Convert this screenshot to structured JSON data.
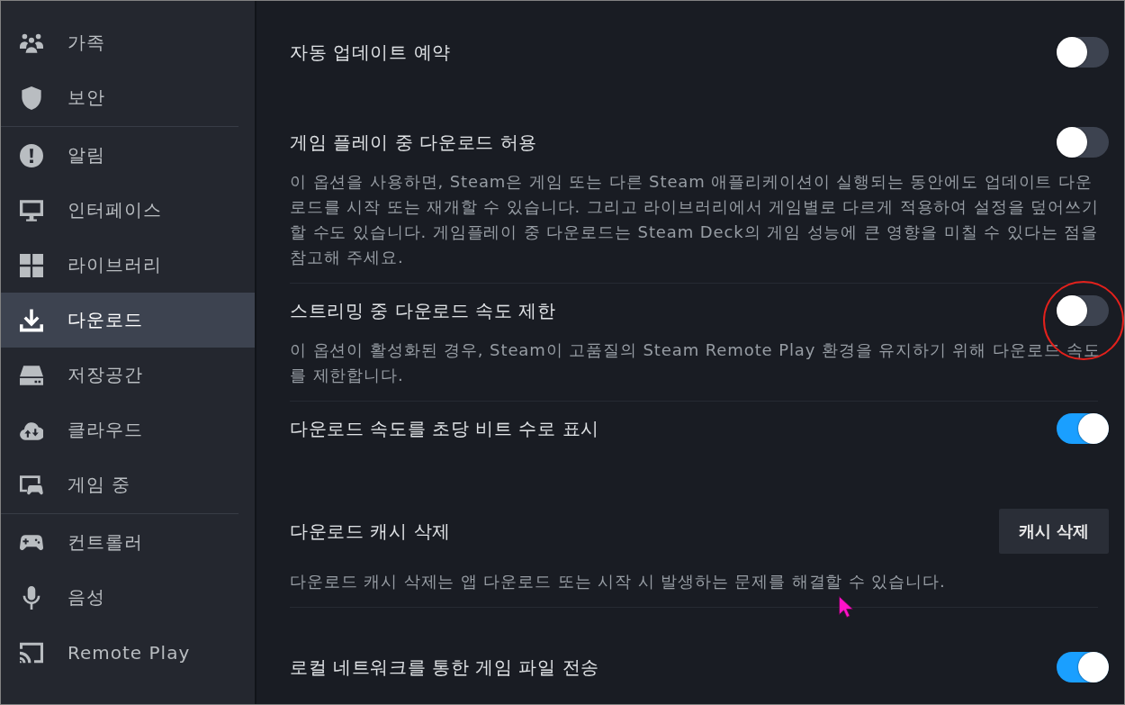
{
  "sidebar": {
    "groups": [
      {
        "items": [
          {
            "label": "가족",
            "selected": false
          },
          {
            "label": "보안",
            "selected": false
          }
        ]
      },
      {
        "items": [
          {
            "label": "알림",
            "selected": false
          },
          {
            "label": "인터페이스",
            "selected": false
          },
          {
            "label": "라이브러리",
            "selected": false
          },
          {
            "label": "다운로드",
            "selected": true
          },
          {
            "label": "저장공간",
            "selected": false
          },
          {
            "label": "클라우드",
            "selected": false
          },
          {
            "label": "게임 중",
            "selected": false
          }
        ]
      },
      {
        "items": [
          {
            "label": "컨트롤러",
            "selected": false
          },
          {
            "label": "음성",
            "selected": false
          },
          {
            "label": "Remote Play",
            "selected": false
          }
        ]
      }
    ]
  },
  "sections": [
    {
      "rows": [
        {
          "kind": "toggle",
          "title": "자동 업데이트 예약",
          "on": false
        }
      ]
    },
    {
      "rows": [
        {
          "kind": "toggle",
          "title": "게임 플레이 중 다운로드 허용",
          "on": false,
          "description": "이 옵션을 사용하면, Steam은 게임 또는 다른 Steam 애플리케이션이 실행되는 동안에도 업데이트 다운로드를 시작 또는 재개할 수 있습니다. 그리고 라이브러리에서 게임별로 다르게 적용하여 설정을 덮어쓰기할 수도 있습니다. 게임플레이 중 다운로드는 Steam Deck의 게임 성능에 큰 영향을 미칠 수 있다는 점을 참고해 주세요."
        },
        {
          "kind": "toggle",
          "title": "스트리밍 중 다운로드 속도 제한",
          "on": false,
          "description": "이 옵션이 활성화된 경우, Steam이 고품질의 Steam Remote Play 환경을 유지하기 위해 다운로드 속도를 제한합니다."
        },
        {
          "kind": "toggle",
          "title": "다운로드 속도를 초당 비트 수로 표시",
          "on": true
        }
      ]
    },
    {
      "rows": [
        {
          "kind": "button",
          "title": "다운로드 캐시 삭제",
          "button": "캐시 삭제",
          "description": "다운로드 캐시 삭제는 앱 다운로드 또는 시작 시 발생하는 문제를 해결할 수 있습니다."
        }
      ]
    },
    {
      "rows": [
        {
          "kind": "toggle",
          "title": "로컬 네트워크를 통한 게임 파일 전송",
          "on": true
        }
      ]
    }
  ]
}
